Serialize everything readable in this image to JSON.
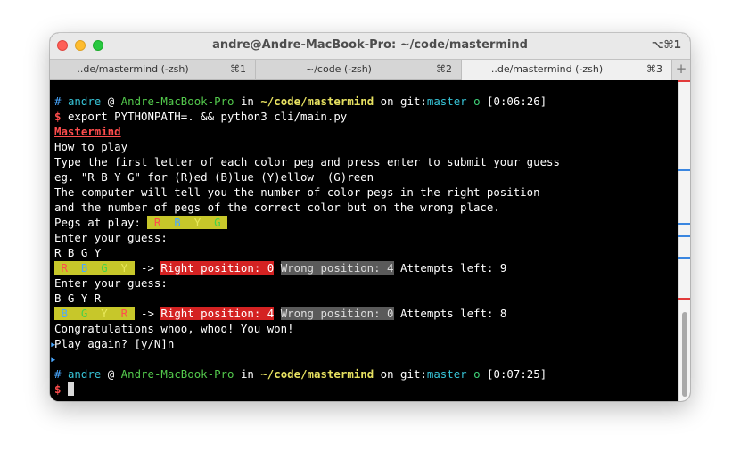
{
  "window": {
    "title": "andre@Andre-MacBook-Pro: ~/code/mastermind",
    "shortcut": "⌥⌘1"
  },
  "tabs": [
    {
      "label": "..de/mastermind (-zsh)",
      "key": "⌘1",
      "active": false
    },
    {
      "label": "~/code (-zsh)",
      "key": "⌘2",
      "active": false
    },
    {
      "label": "..de/mastermind (-zsh)",
      "key": "⌘3",
      "active": true
    }
  ],
  "new_tab": "+",
  "prompt1": {
    "hash": "#",
    "user": "andre",
    "at": "@",
    "host": "Andre-MacBook-Pro",
    "in": "in",
    "path": "~/code/mastermind",
    "on": "on",
    "git": "git:",
    "branch": "master",
    "status": "o",
    "time": "[0:06:26]"
  },
  "command": {
    "sign": "$",
    "text": "export PYTHONPATH=. && python3 cli/main.py"
  },
  "game": {
    "title": "Mastermind",
    "how_to": "How to play",
    "rules1": "Type the first letter of each color peg and press enter to submit your guess",
    "rules2": "eg. \"R B Y G\" for (R)ed (B)lue (Y)ellow  (G)reen",
    "rules3": "The computer will tell you the number of color pegs in the right position",
    "rules4": "and the number of pegs of the correct color but on the wrong place.",
    "pegs_label": "Pegs at play:",
    "pegs": [
      " R ",
      " B ",
      " Y ",
      " G "
    ],
    "enter_guess": "Enter your guess:",
    "guess1": "R B G Y",
    "result1": {
      "pegs": [
        " R ",
        " B ",
        " G ",
        " Y "
      ],
      "arrow": " -> ",
      "right": "Right position: 0",
      "wrong": "Wrong position: 4",
      "attempts": " Attempts left: 9"
    },
    "guess2": "B G Y R",
    "result2": {
      "pegs": [
        " B ",
        " G ",
        " Y ",
        " R "
      ],
      "arrow": " -> ",
      "right": "Right position: 4",
      "wrong": "Wrong position: 0",
      "attempts": " Attempts left: 8"
    },
    "congrats": "Congratulations whoo, whoo! You won!",
    "play_again": "Play again? [y/N]n"
  },
  "prompt2": {
    "hash": "#",
    "user": "andre",
    "at": "@",
    "host": "Andre-MacBook-Pro",
    "in": "in",
    "path": "~/code/mastermind",
    "on": "on",
    "git": "git:",
    "branch": "master",
    "status": "o",
    "time": "[0:07:25]"
  },
  "prompt_sign": "$"
}
